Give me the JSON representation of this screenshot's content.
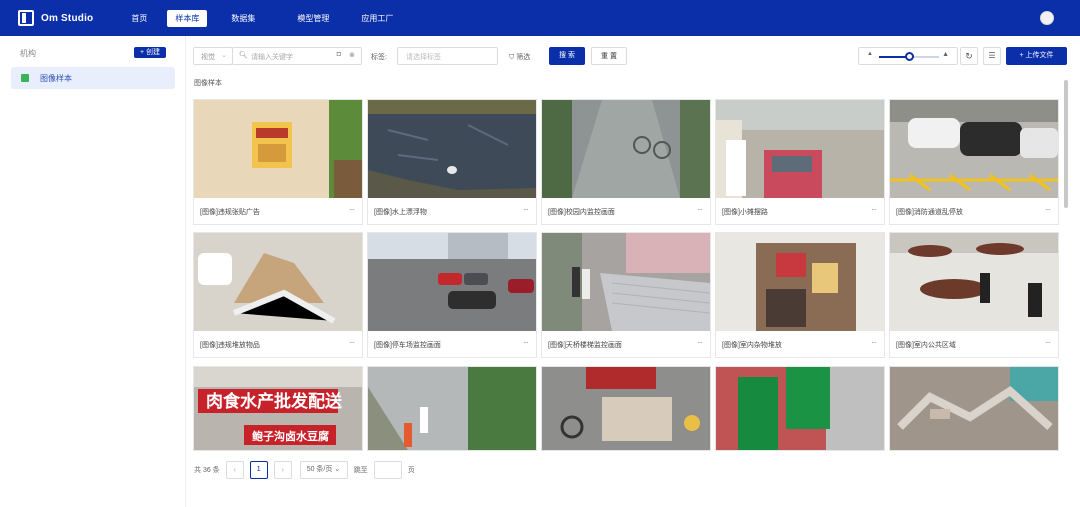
{
  "app": {
    "title": "Om Studio"
  },
  "nav": [
    {
      "label": "首页",
      "active": false
    },
    {
      "label": "样本库",
      "active": true
    },
    {
      "label": "数据集",
      "active": false
    },
    {
      "label": "模型管理",
      "active": false
    },
    {
      "label": "应用工厂",
      "active": false
    }
  ],
  "sidebar": {
    "header": "机构",
    "create_label": "+ 创建",
    "items": [
      {
        "label": "图像样本",
        "icon": "image-icon"
      }
    ]
  },
  "toolbar": {
    "type_select": "视觉",
    "search_placeholder": "请输入关键字",
    "tag_label": "标签:",
    "tag_placeholder": "请选择标签",
    "filter_label": "筛选",
    "search_button": "搜 索",
    "reset_button": "重 置",
    "zoom_level": 0.5,
    "upload_button": "+ 上传文件"
  },
  "section_title": "图像样本",
  "cards": [
    {
      "caption": "[图像]违规张贴广告"
    },
    {
      "caption": "[图像]水上漂浮物"
    },
    {
      "caption": "[图像]校园内监控画面"
    },
    {
      "caption": "[图像]小摊摆路"
    },
    {
      "caption": "[图像]消防通道乱停放"
    },
    {
      "caption": "[图像]违规堆放物品"
    },
    {
      "caption": "[图像]停车场监控画面"
    },
    {
      "caption": "[图像]天桥楼梯监控画面"
    },
    {
      "caption": "[图像]室内杂物堆放"
    },
    {
      "caption": "[图像]室内公共区域"
    },
    {
      "caption": ""
    },
    {
      "caption": ""
    },
    {
      "caption": ""
    },
    {
      "caption": ""
    },
    {
      "caption": ""
    }
  ],
  "sign_text": {
    "line1": "肉食水产批发配送",
    "line2": "鲍子沟卤水豆腐"
  },
  "pagination": {
    "total": "共 36 条",
    "current_page": "1",
    "page_size": "50 条/页",
    "jump_label": "跳至",
    "page_suffix": "页"
  },
  "colors": {
    "brand": "#0a2fa8"
  }
}
